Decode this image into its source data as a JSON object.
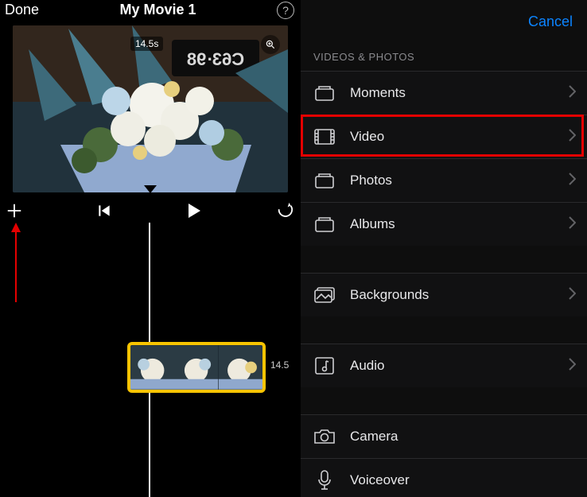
{
  "editor": {
    "done": "Done",
    "title": "My Movie 1",
    "duration_badge": "14.5s",
    "clip_time": "14.5"
  },
  "picker": {
    "cancel": "Cancel",
    "section": "VIDEOS & PHOTOS",
    "rows": {
      "moments": "Moments",
      "video": "Video",
      "photos": "Photos",
      "albums": "Albums",
      "backgrounds": "Backgrounds",
      "audio": "Audio",
      "camera": "Camera",
      "voiceover": "Voiceover"
    }
  },
  "highlight": {
    "target": "video"
  }
}
